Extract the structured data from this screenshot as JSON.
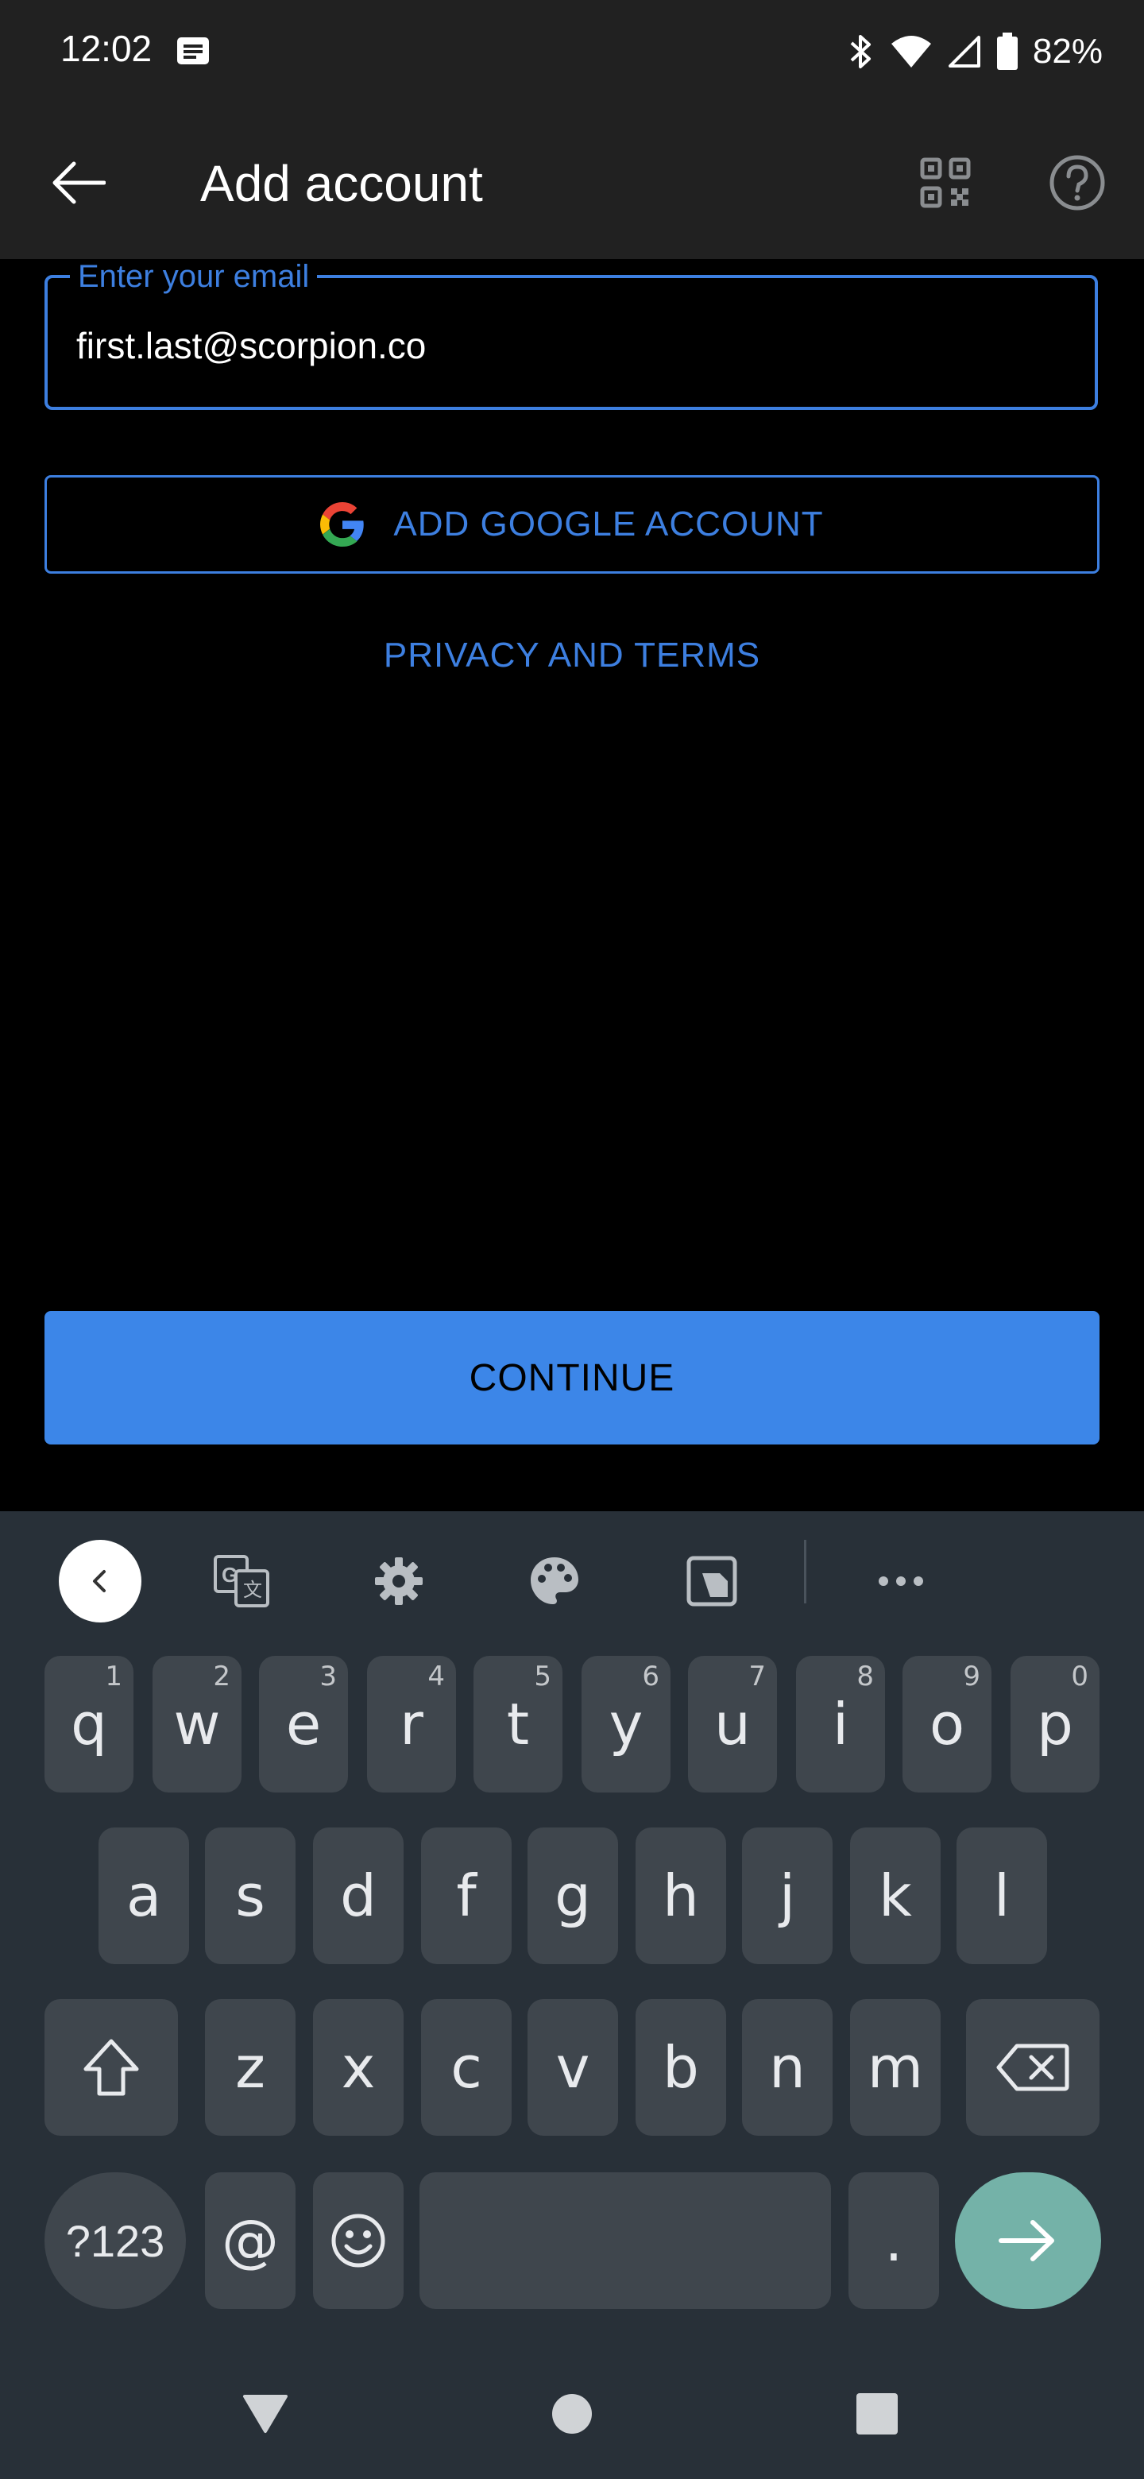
{
  "status_bar": {
    "time": "12:02",
    "battery": "82%"
  },
  "app_bar": {
    "title": "Add account"
  },
  "email": {
    "label": "Enter your email",
    "value": "first.last@scorpion.co"
  },
  "google_button": {
    "label": "ADD GOOGLE ACCOUNT"
  },
  "privacy_link": {
    "label": "PRIVACY AND TERMS"
  },
  "continue_button": {
    "label": "CONTINUE"
  },
  "keyboard": {
    "row1": [
      {
        "key": "q",
        "hint": "1"
      },
      {
        "key": "w",
        "hint": "2"
      },
      {
        "key": "e",
        "hint": "3"
      },
      {
        "key": "r",
        "hint": "4"
      },
      {
        "key": "t",
        "hint": "5"
      },
      {
        "key": "y",
        "hint": "6"
      },
      {
        "key": "u",
        "hint": "7"
      },
      {
        "key": "i",
        "hint": "8"
      },
      {
        "key": "o",
        "hint": "9"
      },
      {
        "key": "p",
        "hint": "0"
      }
    ],
    "row2": [
      "a",
      "s",
      "d",
      "f",
      "g",
      "h",
      "j",
      "k",
      "l"
    ],
    "row3": [
      "z",
      "x",
      "c",
      "v",
      "b",
      "n",
      "m"
    ],
    "symbols_label": "?123",
    "at_label": "@",
    "period_label": "."
  }
}
